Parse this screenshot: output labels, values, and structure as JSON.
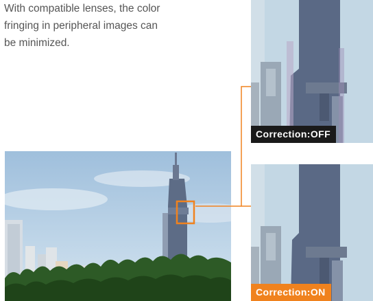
{
  "description": {
    "line1": "With compatible lenses, the color",
    "line2": "fringing in peripheral images can",
    "line3": "be minimized."
  },
  "crops": {
    "off_label": "Correction:OFF",
    "on_label": "Correction:ON"
  },
  "colors": {
    "accent": "#f0821e",
    "off_badge": "#1a1a1a",
    "sky": "#b9d2e6",
    "tower": "#5d6c86"
  }
}
